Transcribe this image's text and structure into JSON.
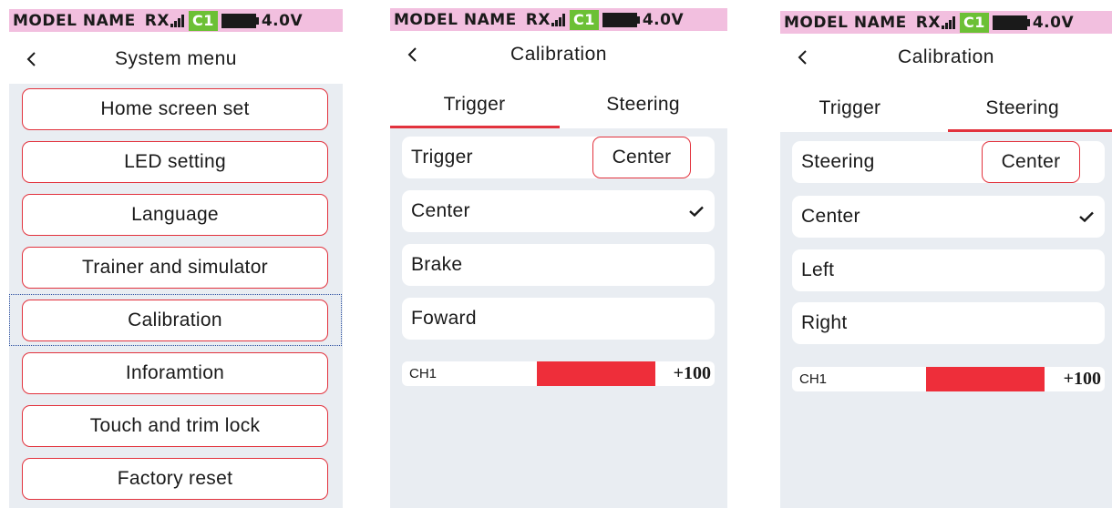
{
  "status": {
    "model": "MODEL NAME",
    "rx": "RX",
    "channel": "C1",
    "voltage": "4.0V"
  },
  "colors": {
    "accent": "#e2323d",
    "status_bar": "#f2bfdf",
    "channel_badge": "#6cc035",
    "panel_bg": "#e9edf2",
    "focus": "#2a4ea0"
  },
  "screen1": {
    "title": "System menu",
    "items": [
      "Home screen set",
      "LED setting",
      "Language",
      "Trainer and simulator",
      "Calibration",
      "Inforamtion",
      "Touch and trim lock",
      "Factory reset"
    ],
    "focused_item": "Calibration"
  },
  "screen2": {
    "title": "Calibration",
    "tabs": [
      "Trigger",
      "Steering"
    ],
    "active_tab": "Trigger",
    "mode_label": "Trigger",
    "center_button": "Center",
    "options": [
      "Center",
      "Brake",
      "Foward"
    ],
    "selected_option": "Center",
    "channel": {
      "label": "CH1",
      "value": "+100",
      "fill_fraction": 0.38
    }
  },
  "screen3": {
    "title": "Calibration",
    "tabs": [
      "Trigger",
      "Steering"
    ],
    "active_tab": "Steering",
    "mode_label": "Steering",
    "center_button": "Center",
    "options": [
      "Center",
      "Left",
      "Right"
    ],
    "selected_option": "Center",
    "channel": {
      "label": "CH1",
      "value": "+100",
      "fill_fraction": 0.38
    }
  },
  "icons": {
    "back": "chevron-left-icon",
    "check": "check-icon",
    "signal": "signal-bars-icon",
    "battery": "battery-icon"
  }
}
